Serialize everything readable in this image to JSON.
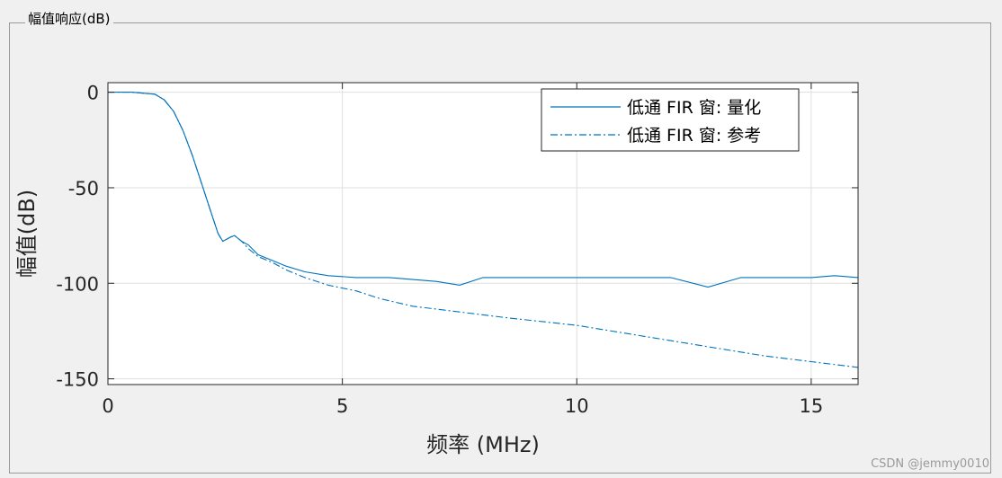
{
  "panel": {
    "title": "幅值响应(dB)"
  },
  "watermark": "CSDN @jemmy0010",
  "colors": {
    "series": "#0072bd",
    "grid": "#dfdfdf",
    "axis": "#262626",
    "background": "#f0f0f0"
  },
  "chart_data": {
    "type": "line",
    "title": "",
    "xlabel": "频率 (MHz)",
    "ylabel": "幅值(dB)",
    "xlim": [
      0,
      16
    ],
    "ylim": [
      -153,
      5
    ],
    "xticks": [
      0,
      5,
      10,
      15
    ],
    "yticks": [
      0,
      -50,
      -100,
      -150
    ],
    "grid": true,
    "legend_position": "top-right",
    "series": [
      {
        "name": "低通 FIR 窗: 量化",
        "style": "solid",
        "x": [
          0,
          0.5,
          1.0,
          1.2,
          1.4,
          1.6,
          1.8,
          2.0,
          2.2,
          2.35,
          2.45,
          2.6,
          2.7,
          2.85,
          3.0,
          3.2,
          3.5,
          3.8,
          4.2,
          4.7,
          5.3,
          6.0,
          7.0,
          7.5,
          8.0,
          9.0,
          10.0,
          11.0,
          12.0,
          12.8,
          13.5,
          14.5,
          15.0,
          15.5,
          16.0
        ],
        "y": [
          0,
          0,
          -1,
          -4,
          -10,
          -20,
          -33,
          -48,
          -63,
          -74,
          -78,
          -76,
          -75,
          -78,
          -80,
          -85,
          -88,
          -91,
          -94,
          -96,
          -97,
          -97,
          -99,
          -101,
          -97,
          -97,
          -97,
          -97,
          -97,
          -102,
          -97,
          -97,
          -97,
          -96,
          -97
        ]
      },
      {
        "name": "低通 FIR 窗: 参考",
        "style": "dashdot",
        "x": [
          0,
          0.5,
          1.0,
          1.2,
          1.4,
          1.6,
          1.8,
          2.0,
          2.2,
          2.35,
          2.45,
          2.6,
          2.7,
          2.85,
          3.0,
          3.2,
          3.5,
          3.8,
          4.2,
          4.7,
          5.3,
          5.8,
          6.5,
          7.5,
          8.5,
          10.0,
          11.0,
          12.0,
          13.0,
          14.0,
          15.0,
          16.0
        ],
        "y": [
          0,
          0,
          -1,
          -4,
          -10,
          -20,
          -33,
          -48,
          -63,
          -74,
          -78,
          -76,
          -75,
          -78,
          -82,
          -86,
          -89,
          -93,
          -97,
          -101,
          -104,
          -108,
          -112,
          -115,
          -118,
          -122,
          -126,
          -130,
          -134,
          -138,
          -141,
          -144
        ]
      }
    ]
  }
}
